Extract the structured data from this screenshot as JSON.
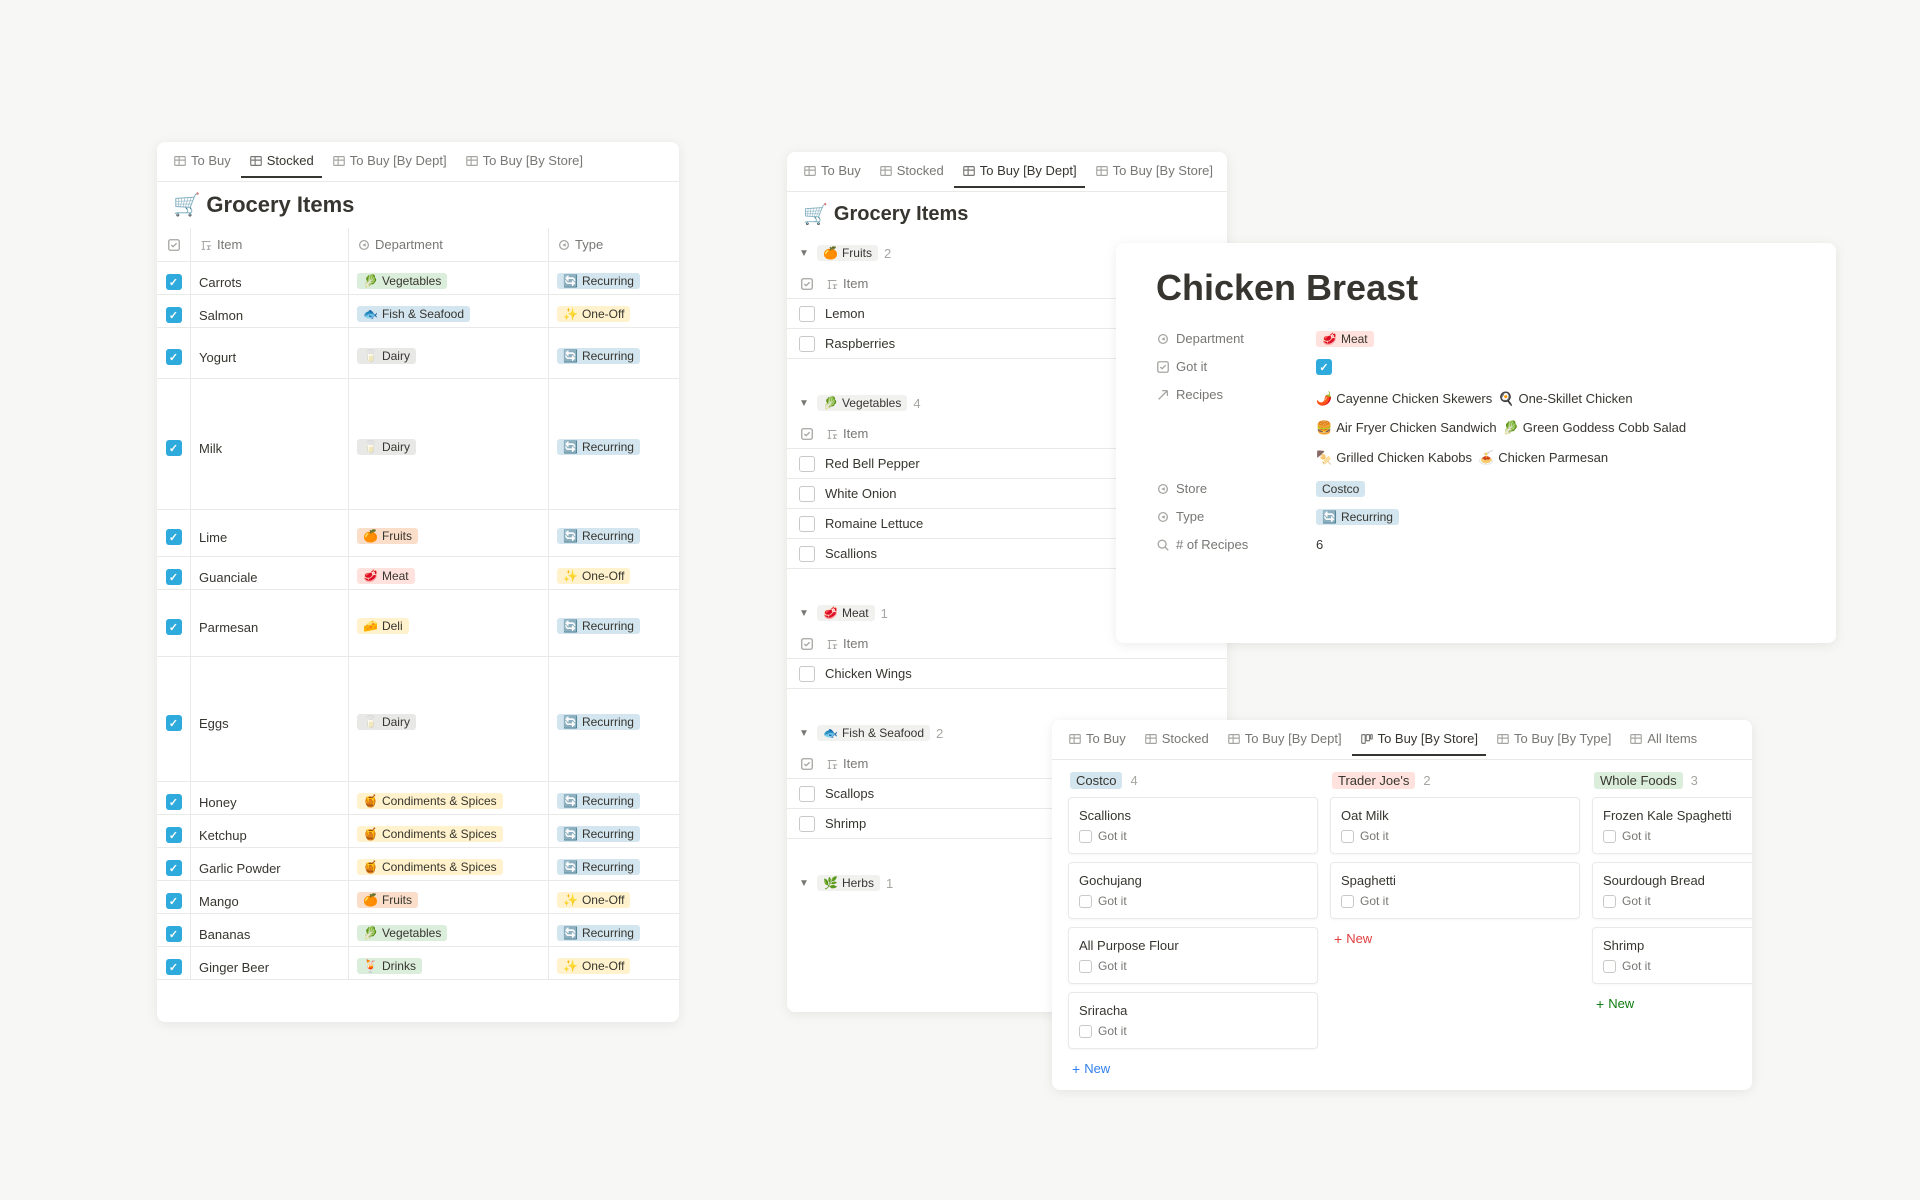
{
  "panel1": {
    "tabs": [
      "To Buy",
      "Stocked",
      "To Buy [By Dept]",
      "To Buy [By Store]"
    ],
    "active_tab": "Stocked",
    "title_emoji": "🛒",
    "title": "Grocery Items",
    "columns": {
      "item": "Item",
      "department": "Department",
      "type": "Type"
    },
    "rows": [
      {
        "checked": true,
        "item": "Carrots",
        "dept_emoji": "🥬",
        "dept": "Vegetables",
        "dept_cls": "tag-green",
        "type_emoji": "🔄",
        "type": "Recurring",
        "type_cls": "tag-blue"
      },
      {
        "checked": true,
        "item": "Salmon",
        "dept_emoji": "🐟",
        "dept": "Fish & Seafood",
        "dept_cls": "tag-blue",
        "type_emoji": "✨",
        "type": "One-Off",
        "type_cls": "tag-yellow"
      },
      {
        "checked": true,
        "item": "Yogurt",
        "dept_emoji": "🥛",
        "dept": "Dairy",
        "dept_cls": "tag-gray",
        "type_emoji": "🔄",
        "type": "Recurring",
        "type_cls": "tag-blue",
        "extra_h": 18
      },
      {
        "checked": true,
        "item": "Milk",
        "dept_emoji": "🥛",
        "dept": "Dairy",
        "dept_cls": "tag-gray",
        "type_emoji": "🔄",
        "type": "Recurring",
        "type_cls": "tag-blue",
        "extra_h": 98
      },
      {
        "checked": true,
        "item": "Lime",
        "dept_emoji": "🍊",
        "dept": "Fruits",
        "dept_cls": "tag-orange",
        "type_emoji": "🔄",
        "type": "Recurring",
        "type_cls": "tag-blue",
        "extra_h": 14
      },
      {
        "checked": true,
        "item": "Guanciale",
        "dept_emoji": "🥩",
        "dept": "Meat",
        "dept_cls": "tag-red",
        "type_emoji": "✨",
        "type": "One-Off",
        "type_cls": "tag-yellow"
      },
      {
        "checked": true,
        "item": "Parmesan",
        "dept_emoji": "🧀",
        "dept": "Deli",
        "dept_cls": "tag-yellow",
        "type_emoji": "🔄",
        "type": "Recurring",
        "type_cls": "tag-blue",
        "extra_h": 34
      },
      {
        "checked": true,
        "item": "Eggs",
        "dept_emoji": "🥛",
        "dept": "Dairy",
        "dept_cls": "tag-gray",
        "type_emoji": "🔄",
        "type": "Recurring",
        "type_cls": "tag-blue",
        "extra_h": 92
      },
      {
        "checked": true,
        "item": "Honey",
        "dept_emoji": "🍯",
        "dept": "Condiments & Spices",
        "dept_cls": "tag-yellow",
        "type_emoji": "🔄",
        "type": "Recurring",
        "type_cls": "tag-blue"
      },
      {
        "checked": true,
        "item": "Ketchup",
        "dept_emoji": "🍯",
        "dept": "Condiments & Spices",
        "dept_cls": "tag-yellow",
        "type_emoji": "🔄",
        "type": "Recurring",
        "type_cls": "tag-blue"
      },
      {
        "checked": true,
        "item": "Garlic Powder",
        "dept_emoji": "🍯",
        "dept": "Condiments & Spices",
        "dept_cls": "tag-yellow",
        "type_emoji": "🔄",
        "type": "Recurring",
        "type_cls": "tag-blue"
      },
      {
        "checked": true,
        "item": "Mango",
        "dept_emoji": "🍊",
        "dept": "Fruits",
        "dept_cls": "tag-orange",
        "type_emoji": "✨",
        "type": "One-Off",
        "type_cls": "tag-yellow"
      },
      {
        "checked": true,
        "item": "Bananas",
        "dept_emoji": "🥬",
        "dept": "Vegetables",
        "dept_cls": "tag-green",
        "type_emoji": "🔄",
        "type": "Recurring",
        "type_cls": "tag-blue"
      },
      {
        "checked": true,
        "item": "Ginger Beer",
        "dept_emoji": "🍹",
        "dept": "Drinks",
        "dept_cls": "tag-green",
        "type_emoji": "✨",
        "type": "One-Off",
        "type_cls": "tag-yellow"
      }
    ]
  },
  "panel2": {
    "tabs": [
      "To Buy",
      "Stocked",
      "To Buy [By Dept]",
      "To Buy [By Store]"
    ],
    "active_tab": "To Buy [By Dept]",
    "title_emoji": "🛒",
    "title": "Grocery Items",
    "item_col": "Item",
    "groups": [
      {
        "emoji": "🍊",
        "name": "Fruits",
        "count": 2,
        "items": [
          "Lemon",
          "Raspberries"
        ]
      },
      {
        "emoji": "🥬",
        "name": "Vegetables",
        "count": 4,
        "items": [
          "Red Bell Pepper",
          "White Onion",
          "Romaine Lettuce",
          "Scallions"
        ]
      },
      {
        "emoji": "🥩",
        "name": "Meat",
        "count": 1,
        "items": [
          "Chicken Wings"
        ]
      },
      {
        "emoji": "🐟",
        "name": "Fish & Seafood",
        "count": 2,
        "items": [
          "Scallops",
          "Shrimp"
        ]
      },
      {
        "emoji": "🌿",
        "name": "Herbs",
        "count": 1,
        "items": []
      }
    ]
  },
  "detail": {
    "title": "Chicken Breast",
    "props": {
      "department_label": "Department",
      "department_emoji": "🥩",
      "department_value": "Meat",
      "gotit_label": "Got it",
      "gotit_checked": true,
      "recipes_label": "Recipes",
      "recipes": [
        {
          "emoji": "🌶️",
          "name": "Cayenne Chicken Skewers"
        },
        {
          "emoji": "🍳",
          "name": "One-Skillet Chicken"
        },
        {
          "emoji": "🍔",
          "name": "Air Fryer Chicken Sandwich"
        },
        {
          "emoji": "🥬",
          "name": "Green Goddess Cobb Salad"
        },
        {
          "emoji": "🍢",
          "name": "Grilled Chicken Kabobs"
        },
        {
          "emoji": "🍝",
          "name": "Chicken Parmesan"
        }
      ],
      "store_label": "Store",
      "store_value": "Costco",
      "type_label": "Type",
      "type_emoji": "🔄",
      "type_value": "Recurring",
      "count_label": "# of Recipes",
      "count_value": "6"
    }
  },
  "panel4": {
    "tabs": [
      "To Buy",
      "Stocked",
      "To Buy [By Dept]",
      "To Buy [By Store]",
      "To Buy [By Type]",
      "All Items"
    ],
    "active_tab": "To Buy [By Store]",
    "gotit_label": "Got it",
    "new_label": "New",
    "columns": [
      {
        "name": "Costco",
        "count": 4,
        "pill_cls": "tag-blue",
        "new_cls": "blue",
        "cards": [
          "Scallions",
          "Gochujang",
          "All Purpose Flour",
          "Sriracha"
        ]
      },
      {
        "name": "Trader Joe's",
        "count": 2,
        "pill_cls": "tag-red",
        "new_cls": "red",
        "cards": [
          "Oat Milk",
          "Spaghetti"
        ]
      },
      {
        "name": "Whole Foods",
        "count": 3,
        "pill_cls": "tag-green",
        "new_cls": "green",
        "cards": [
          "Frozen Kale Spaghetti",
          "Sourdough Bread",
          "Shrimp"
        ]
      }
    ]
  }
}
